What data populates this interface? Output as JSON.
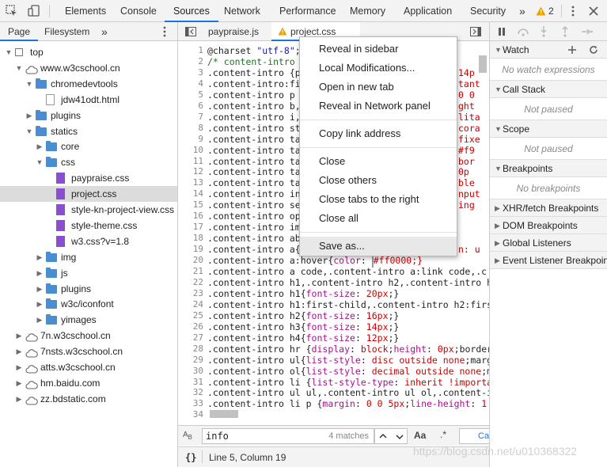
{
  "toolbar": {
    "tabs": [
      "Elements",
      "Console",
      "Sources",
      "Network",
      "Performance",
      "Memory",
      "Application",
      "Security"
    ],
    "active_tab": "Sources",
    "more_symbol": "»",
    "warning_count": "2"
  },
  "navigator": {
    "tabs": [
      "Page",
      "Filesystem"
    ],
    "more_symbol": "»",
    "tree": [
      {
        "label": "top",
        "type": "frame",
        "expanded": true,
        "depth": 0
      },
      {
        "label": "www.w3cschool.cn",
        "type": "domain",
        "expanded": true,
        "depth": 1
      },
      {
        "label": "chromedevtools",
        "type": "folder",
        "expanded": true,
        "depth": 2
      },
      {
        "label": "jdw41odt.html",
        "type": "doc",
        "depth": 3
      },
      {
        "label": "plugins",
        "type": "folder",
        "expanded": false,
        "depth": 2
      },
      {
        "label": "statics",
        "type": "folder",
        "expanded": true,
        "depth": 2
      },
      {
        "label": "core",
        "type": "folder",
        "expanded": false,
        "depth": 3
      },
      {
        "label": "css",
        "type": "folder",
        "expanded": true,
        "depth": 3
      },
      {
        "label": "paypraise.css",
        "type": "css",
        "depth": 4
      },
      {
        "label": "project.css",
        "type": "css",
        "depth": 4,
        "selected": true
      },
      {
        "label": "style-kn-project-view.css",
        "type": "css",
        "depth": 4
      },
      {
        "label": "style-theme.css",
        "type": "css",
        "depth": 4
      },
      {
        "label": "w3.css?v=1.8",
        "type": "css",
        "depth": 4
      },
      {
        "label": "img",
        "type": "folder",
        "expanded": false,
        "depth": 3
      },
      {
        "label": "js",
        "type": "folder",
        "expanded": false,
        "depth": 3
      },
      {
        "label": "plugins",
        "type": "folder",
        "expanded": false,
        "depth": 3
      },
      {
        "label": "w3c/iconfont",
        "type": "folder",
        "expanded": false,
        "depth": 3
      },
      {
        "label": "yimages",
        "type": "folder",
        "expanded": false,
        "depth": 3
      },
      {
        "label": "7n.w3cschool.cn",
        "type": "domain",
        "expanded": false,
        "depth": 1
      },
      {
        "label": "7nsts.w3cschool.cn",
        "type": "domain",
        "expanded": false,
        "depth": 1
      },
      {
        "label": "atts.w3cschool.cn",
        "type": "domain",
        "expanded": false,
        "depth": 1
      },
      {
        "label": "hm.baidu.com",
        "type": "domain",
        "expanded": false,
        "depth": 1
      },
      {
        "label": "zz.bdstatic.com",
        "type": "domain",
        "expanded": false,
        "depth": 1
      }
    ]
  },
  "editor": {
    "tabs": [
      {
        "label": "paypraise.js",
        "active": false,
        "warning": false
      },
      {
        "label": "project.css",
        "active": true,
        "warning": true
      }
    ],
    "lines": [
      {
        "n": "1",
        "code": "@charset \"utf-8\";"
      },
      {
        "n": "2",
        "code": "/* content-intro s"
      },
      {
        "n": "3",
        "code": ".content-intro {pa"
      },
      {
        "n": "4",
        "code": ".content-intro:fir"
      },
      {
        "n": "5",
        "code": ".content-intro p {"
      },
      {
        "n": "6",
        "code": ".content-intro b,."
      },
      {
        "n": "7",
        "code": ".content-intro i,."
      },
      {
        "n": "8",
        "code": ".content-intro str"
      },
      {
        "n": "9",
        "code": ".content-intro tab"
      },
      {
        "n": "10",
        "code": ".content-intro tab"
      },
      {
        "n": "11",
        "code": ".content-intro tab"
      },
      {
        "n": "12",
        "code": ".content-intro tab"
      },
      {
        "n": "13",
        "code": ".content-intro tab"
      },
      {
        "n": "14",
        "code": ".content-intro inp"
      },
      {
        "n": "15",
        "code": ".content-intro sel"
      },
      {
        "n": "16",
        "code": ".content-intro opt"
      },
      {
        "n": "17",
        "code": ".content-intro imp"
      },
      {
        "n": "18",
        "code": ".content-intro abb"
      },
      {
        "n": "19",
        "code": ".content-intro a{co"
      },
      {
        "n": "20",
        "code": ".content-intro a:hover{color: ■#ff0000;}"
      },
      {
        "n": "21",
        "code": ".content-intro a code,.content-intro a:link code,.c"
      },
      {
        "n": "22",
        "code": ".content-intro h1,.content-intro h2,.content-intro h"
      },
      {
        "n": "23",
        "code": ".content-intro h1{font-size: 20px;}"
      },
      {
        "n": "24",
        "code": ".content-intro h1:first-child,.content-intro h2:firs"
      },
      {
        "n": "25",
        "code": ".content-intro h2{font-size: 16px;}"
      },
      {
        "n": "26",
        "code": ".content-intro h3{font-size: 14px;}"
      },
      {
        "n": "27",
        "code": ".content-intro h4{font-size: 12px;}"
      },
      {
        "n": "28",
        "code": ".content-intro hr {display: block;height: 0px;border"
      },
      {
        "n": "29",
        "code": ".content-intro ul{list-style: disc outside none;marg"
      },
      {
        "n": "30",
        "code": ".content-intro ol{list-style: decimal outside none;m"
      },
      {
        "n": "31",
        "code": ".content-intro li {list-style-type: inherit !importa"
      },
      {
        "n": "32",
        "code": ".content-intro ul ul,.content-intro ul ol,.content-i"
      },
      {
        "n": "33",
        "code": ".content-intro li p {margin: 0 0 5px;line-height: 1"
      },
      {
        "n": "34",
        "code": ""
      }
    ],
    "overflow_fragments": [
      {
        "line": 3,
        "text": "14p"
      },
      {
        "line": 4,
        "text": "tant"
      },
      {
        "line": 5,
        "text": "0 0"
      },
      {
        "line": 6,
        "text": "ght"
      },
      {
        "line": 7,
        "text": "lita"
      },
      {
        "line": 8,
        "text": "cora"
      },
      {
        "line": 9,
        "text": "fixe"
      },
      {
        "line": 10,
        "text": "#f9"
      },
      {
        "line": 11,
        "text": "bor"
      },
      {
        "line": 12,
        "text": "0p"
      },
      {
        "line": 13,
        "text": "ble"
      },
      {
        "line": 14,
        "text": "nput"
      },
      {
        "line": 15,
        "text": "ing"
      },
      {
        "line": 19,
        "text": "n: u"
      }
    ],
    "search": {
      "value": "info",
      "matches": "4 matches",
      "match_case_label": "Aa",
      "regex_label": ".*",
      "cancel_label": "Ca"
    },
    "status": {
      "pretty_print": "{}",
      "position": "Line 5, Column 19"
    }
  },
  "context_menu": {
    "items": [
      {
        "label": "Reveal in sidebar",
        "group": 1
      },
      {
        "label": "Local Modifications...",
        "group": 1
      },
      {
        "label": "Open in new tab",
        "group": 1
      },
      {
        "label": "Reveal in Network panel",
        "group": 1
      },
      {
        "label": "Copy link address",
        "group": 2
      },
      {
        "label": "Close",
        "group": 3
      },
      {
        "label": "Close others",
        "group": 3
      },
      {
        "label": "Close tabs to the right",
        "group": 3
      },
      {
        "label": "Close all",
        "group": 3
      },
      {
        "label": "Save as...",
        "group": 4,
        "hover": true
      }
    ]
  },
  "debugger": {
    "watch": {
      "title": "Watch",
      "empty": "No watch expressions"
    },
    "call_stack": {
      "title": "Call Stack",
      "empty": "Not paused"
    },
    "scope": {
      "title": "Scope",
      "empty": "Not paused"
    },
    "breakpoints": {
      "title": "Breakpoints",
      "empty": "No breakpoints"
    },
    "collapsed_panes": [
      "XHR/fetch Breakpoints",
      "DOM Breakpoints",
      "Global Listeners",
      "Event Listener Breakpoints"
    ]
  },
  "watermark": "https://blog.csdn.net/u010368322",
  "colors": {
    "accent": "#1a73e8",
    "folder": "#4a8ed1",
    "css_file": "#8a4ed1",
    "warning": "#e8a300",
    "red_swatch": "#ff0000"
  }
}
